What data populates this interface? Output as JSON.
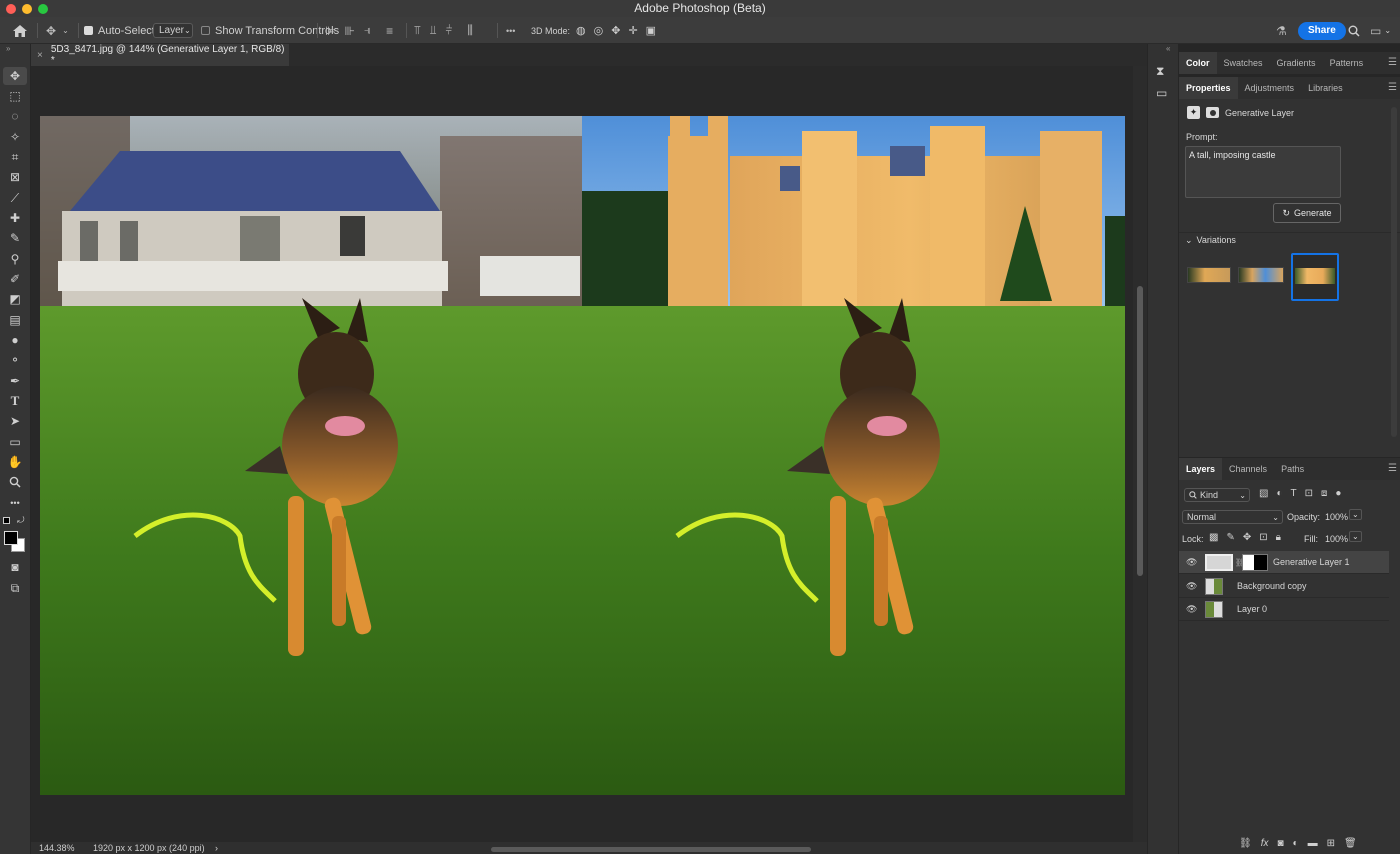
{
  "window": {
    "title": "Adobe Photoshop (Beta)"
  },
  "options_bar": {
    "auto_select_label": "Auto-Select:",
    "auto_select_value": "Layer",
    "transform_controls_label": "Show Transform Controls",
    "mode_3d_label": "3D Mode:",
    "more_glyph": "•••",
    "share_label": "Share"
  },
  "document": {
    "tab_title": "5D3_8471.jpg @ 144% (Generative Layer 1, RGB/8) *",
    "zoom": "144.38%",
    "info": "1920 px x 1200 px (240 ppi)",
    "info_arrow": "›"
  },
  "color_panel": {
    "tabs": [
      "Color",
      "Swatches",
      "Gradients",
      "Patterns"
    ]
  },
  "properties_panel": {
    "tabs": [
      "Properties",
      "Adjustments",
      "Libraries"
    ],
    "layer_type": "Generative Layer",
    "prompt_label": "Prompt:",
    "prompt_value": "A tall, imposing castle",
    "generate_label": "Generate",
    "variations_label": "Variations"
  },
  "layers_panel": {
    "tabs": [
      "Layers",
      "Channels",
      "Paths"
    ],
    "filter_kind": "Kind",
    "blend_mode": "Normal",
    "opacity_label": "Opacity:",
    "opacity_value": "100%",
    "lock_label": "Lock:",
    "fill_label": "Fill:",
    "fill_value": "100%",
    "layers": [
      {
        "name": "Generative Layer 1",
        "selected": true
      },
      {
        "name": "Background copy",
        "selected": false
      },
      {
        "name": "Layer 0",
        "selected": false
      }
    ]
  },
  "colors": {
    "accent": "#1473e6",
    "panel_bg": "#323232",
    "app_bg": "#262626"
  }
}
